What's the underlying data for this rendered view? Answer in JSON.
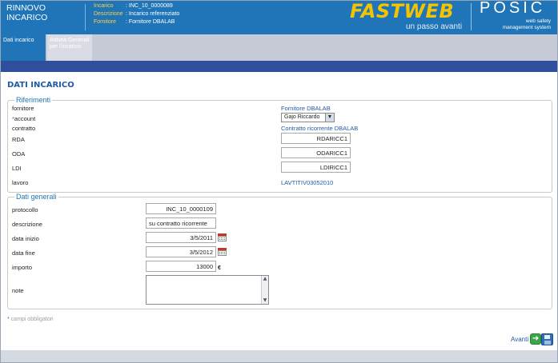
{
  "header": {
    "title_line1": "RINNOVO",
    "title_line2": "INCARICO",
    "meta": [
      {
        "key": "Incarico",
        "value": ": INC_10_0000089"
      },
      {
        "key": "Descrizione",
        "value": ": Incarico referenziato"
      },
      {
        "key": "Fornitore",
        "value": ": Fornitore DBALAB"
      }
    ],
    "brand_fastweb": "FASTWEB",
    "brand_fastweb_tagline": "un passo avanti",
    "brand_posic": "POSIC",
    "brand_posic_sub": [
      "web safety",
      "management system"
    ],
    "colors": {
      "header_bg": "#1f75b8",
      "accent_yellow": "#f4c400",
      "band": "#2e4f9c"
    }
  },
  "tabs": [
    {
      "label": "Dati incarico",
      "active": true
    },
    {
      "label": "Attività Generali per l'incarico",
      "active": false
    }
  ],
  "page": {
    "heading": "DATI INCARICO"
  },
  "riferimenti": {
    "legend": "Riferimenti",
    "fornitore": {
      "label": "fornitore",
      "value": "Fornitore DBALAB"
    },
    "account": {
      "required_mark": "*",
      "label": "account",
      "selected": "Gajo Riccardo"
    },
    "contratto": {
      "label": "contratto",
      "value": "Contratto ricorrente DBALAB"
    },
    "rda": {
      "label": "RDA",
      "value": "RDARICC1"
    },
    "oda": {
      "label": "ODA",
      "value": "ODARICC1"
    },
    "ldi": {
      "label": "LDI",
      "value": "LDIRICC1"
    },
    "lavoro": {
      "label": "lavoro",
      "value": "LAVTITIV03052010"
    }
  },
  "generali": {
    "legend": "Dati generali",
    "protocollo": {
      "label": "protocollo",
      "value": "INC_10_0000109"
    },
    "descrizione": {
      "label": "descrizione",
      "value": "su contratto ricorrente"
    },
    "data_inizio": {
      "label": "data inizio",
      "value": "3/5/2011"
    },
    "data_fine": {
      "label": "data fine",
      "value": "3/5/2012"
    },
    "importo": {
      "label": "importo",
      "value": "13000",
      "currency": "€"
    },
    "note": {
      "label": "note",
      "value": ""
    }
  },
  "footer": {
    "required_star": "*",
    "required_text": " campi obbligatori",
    "next_label": "Avanti"
  }
}
